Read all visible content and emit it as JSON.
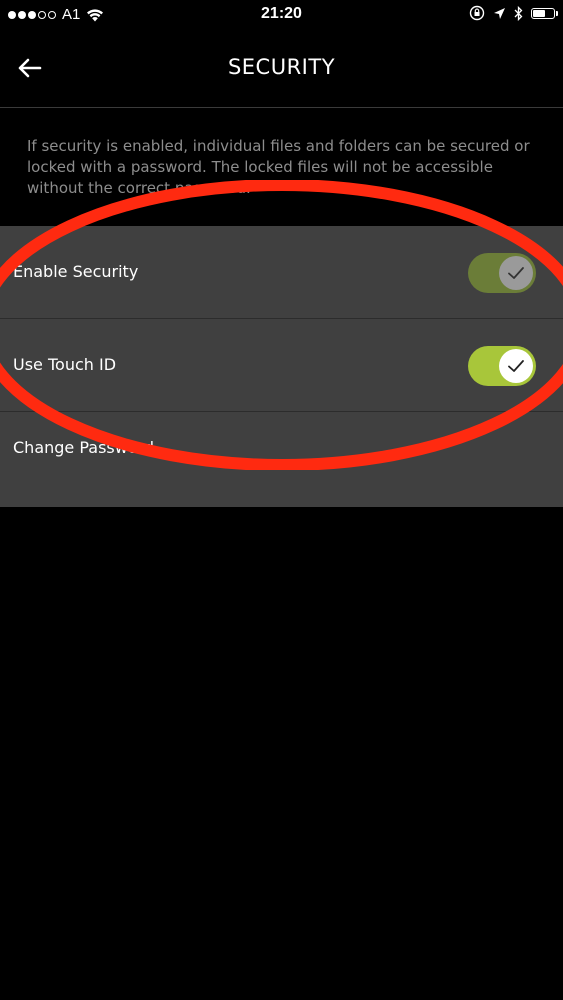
{
  "status_bar": {
    "carrier": "A1",
    "time": "21:20"
  },
  "header": {
    "title": "SECURITY",
    "back_icon": "arrow-left-icon"
  },
  "description": "If security is enabled, individual files and folders can be secured or locked with a password. The locked files will not be accessible without the correct password.",
  "settings": [
    {
      "label": "Enable Security",
      "toggle": true,
      "enabled": true,
      "track_color": "#6b7d38",
      "knob_color": "#9a9a9a"
    },
    {
      "label": "Use Touch ID",
      "toggle": true,
      "enabled": true,
      "track_color": "#a8c63a",
      "knob_color": "#ffffff"
    },
    {
      "label": "Change Password",
      "toggle": false
    }
  ],
  "colors": {
    "background": "#000000",
    "row_background": "#404040",
    "description_text": "#8d8d8d",
    "annotation": "#ff2a10"
  }
}
